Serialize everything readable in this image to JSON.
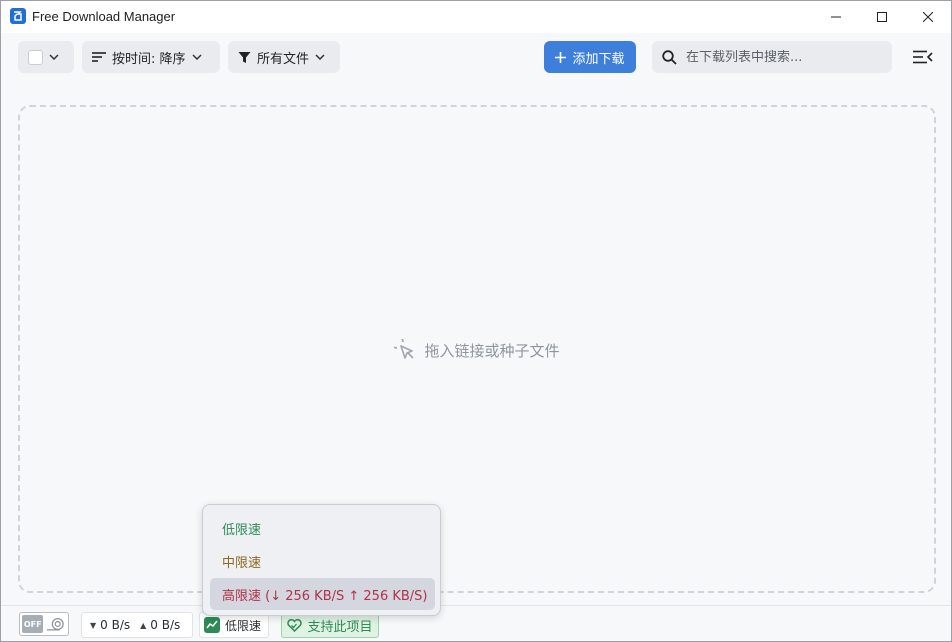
{
  "window": {
    "title": "Free Download Manager"
  },
  "toolbar": {
    "sort_label": "按时间: 降序",
    "filter_label": "所有文件",
    "add_label": "添加下载",
    "search_placeholder": "在下载列表中搜索..."
  },
  "dropzone": {
    "hint": "拖入链接或种子文件"
  },
  "statusbar": {
    "turbo_label": "OFF",
    "download_speed": "0 B/s",
    "upload_speed": "0 B/s",
    "limit_label": "低限速",
    "support_label": "支持此项目"
  },
  "speed_menu": {
    "items": [
      {
        "label": "低限速",
        "color": "#2e8b57"
      },
      {
        "label": "中限速",
        "color": "#8a6a1f"
      },
      {
        "label": "高限速 (↓ 256 KB/S ↑ 256 KB/S)",
        "color": "#b03245"
      }
    ],
    "highlighted_index": 2
  },
  "colors": {
    "accent": "#3f7fdc",
    "support_green": "#2e8b57",
    "background": "#f7f8fa"
  },
  "icons": {
    "app": "fdm-logo-icon",
    "checkbox_dropdown": "chevron-down-icon",
    "sort": "sort-lines-icon",
    "filter": "funnel-icon",
    "add": "plus-icon",
    "search": "search-icon",
    "menu": "hamburger-collapse-icon",
    "drop": "cursor-click-icon",
    "limit": "trend-up-icon",
    "support": "heart-icon"
  }
}
